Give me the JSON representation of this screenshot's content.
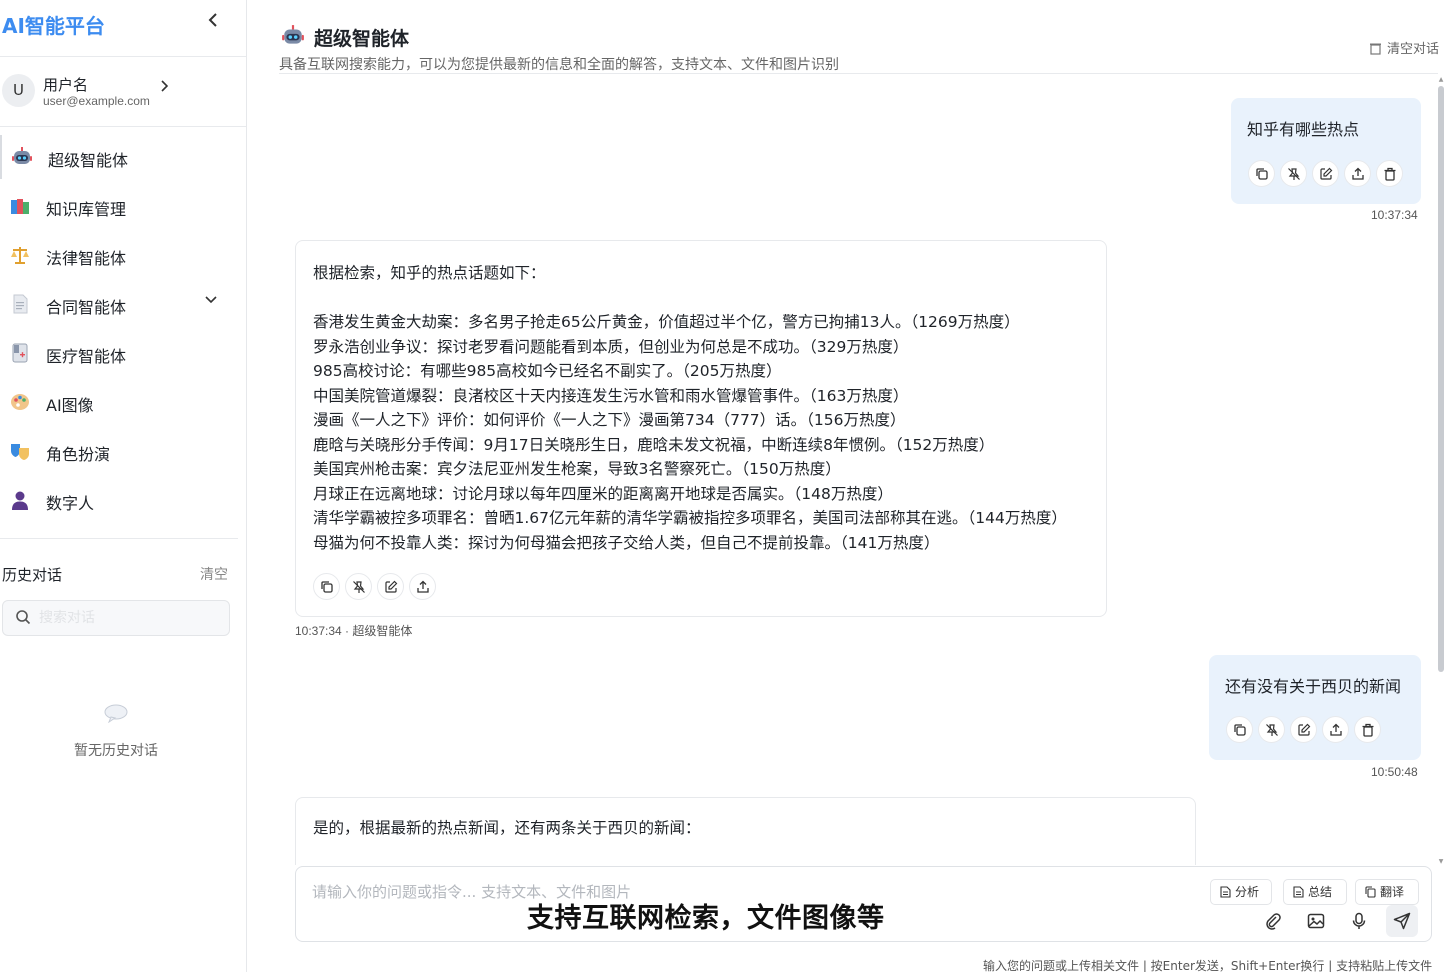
{
  "sidebar": {
    "brand": "AI智能平台",
    "user": {
      "avatar_letter": "U",
      "name": "用户名",
      "email": "user@example.com"
    },
    "nav": [
      {
        "label": "超级智能体",
        "icon": "robot-icon",
        "active": true
      },
      {
        "label": "知识库管理",
        "icon": "books-icon"
      },
      {
        "label": "法律智能体",
        "icon": "scales-icon"
      },
      {
        "label": "合同智能体",
        "icon": "document-icon",
        "expandable": true
      },
      {
        "label": "医疗智能体",
        "icon": "medical-record-icon"
      },
      {
        "label": "AI图像",
        "icon": "palette-icon"
      },
      {
        "label": "角色扮演",
        "icon": "theater-masks-icon"
      },
      {
        "label": "数字人",
        "icon": "person-icon"
      }
    ],
    "history": {
      "title": "历史对话",
      "clear_label": "清空",
      "search_placeholder": "搜索对话",
      "empty_text": "暂无历史对话"
    }
  },
  "header": {
    "title": "超级智能体",
    "subtitle": "具备互联网搜索能力，可以为您提供最新的信息和全面的解答，支持文本、文件和图片识别",
    "clear_label": "清空对话"
  },
  "messages": [
    {
      "role": "user",
      "text": "知乎有哪些热点",
      "time": "10:37:34"
    },
    {
      "role": "assistant",
      "lines": [
        "根据检索，知乎的热点话题如下：",
        "",
        "香港发生黄金大劫案：多名男子抢走65公斤黄金，价值超过半个亿，警方已拘捕13人。（1269万热度）",
        "罗永浩创业争议：探讨老罗看问题能看到本质，但创业为何总是不成功。（329万热度）",
        "985高校讨论：有哪些985高校如今已经名不副实了。（205万热度）",
        "中国美院管道爆裂：良渚校区十天内接连发生污水管和雨水管爆管事件。（163万热度）",
        "漫画《一人之下》评价：如何评价《一人之下》漫画第734（777）话。（156万热度）",
        "鹿晗与关晓彤分手传闻：9月17日关晓彤生日，鹿晗未发文祝福，中断连续8年惯例。（152万热度）",
        "美国宾州枪击案：宾夕法尼亚州发生枪案，导致3名警察死亡。（150万热度）",
        "月球正在远离地球：讨论月球以每年四厘米的距离离开地球是否属实。（148万热度）",
        "清华学霸被控多项罪名：曾晒1.67亿元年薪的清华学霸被指控多项罪名，美国司法部称其在逃。（144万热度）",
        "母猫为何不投靠人类：探讨为何母猫会把孩子交给人类，但自己不提前投靠。（141万热度）"
      ],
      "meta": "10:37:34 · 超级智能体"
    },
    {
      "role": "user",
      "text": "还有没有关于西贝的新闻",
      "time": "10:50:48"
    },
    {
      "role": "assistant",
      "lines": [
        "是的，根据最新的热点新闻，还有两条关于西贝的新闻："
      ]
    }
  ],
  "input": {
    "placeholder": "请输入你的问题或指令... 支持文本、文件和图片",
    "chips": [
      "分析",
      "总结",
      "翻译"
    ],
    "hint": "输入您的问题或上传相关文件 | 按Enter发送，Shift+Enter换行 | 支持粘贴上传文件"
  },
  "overlay_caption": "支持互联网检索，文件图像等",
  "colors": {
    "brand": "#3d8cf0",
    "user_bubble": "#e9f2fc",
    "border": "#e7e9ec"
  }
}
